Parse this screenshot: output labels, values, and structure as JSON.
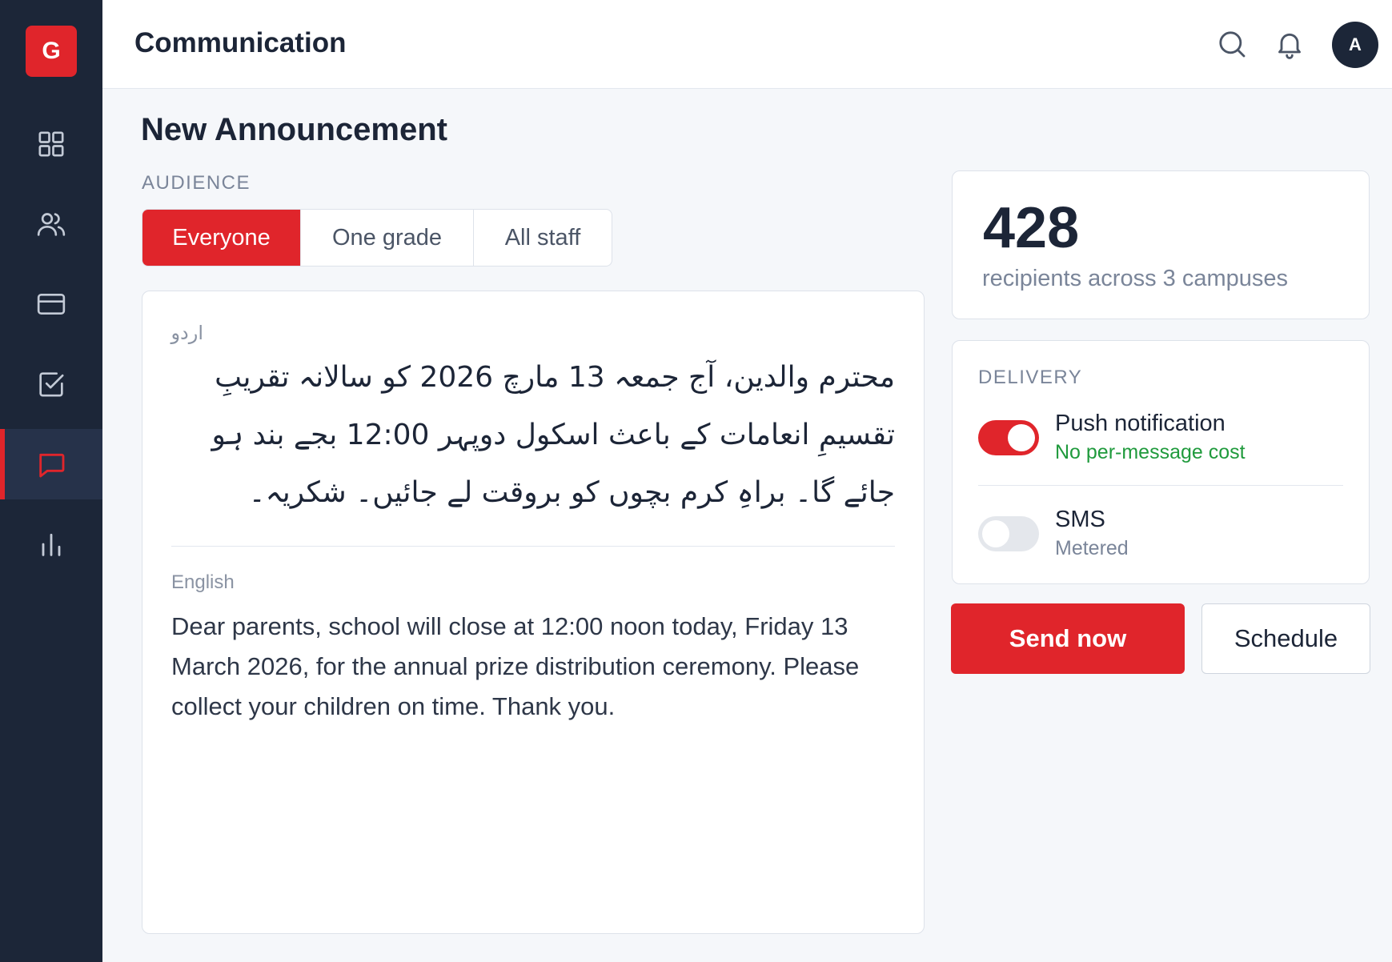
{
  "sidebar": {
    "logo_letter": "G",
    "items": [
      {
        "name": "dashboard",
        "icon": "grid-icon",
        "active": false
      },
      {
        "name": "people",
        "icon": "users-icon",
        "active": false
      },
      {
        "name": "billing",
        "icon": "credit-card-icon",
        "active": false
      },
      {
        "name": "tasks",
        "icon": "checkbox-icon",
        "active": false
      },
      {
        "name": "communication",
        "icon": "message-icon",
        "active": true
      },
      {
        "name": "reports",
        "icon": "bar-chart-icon",
        "active": false
      }
    ]
  },
  "header": {
    "title": "Communication",
    "search_icon": "search-icon",
    "bell_icon": "bell-icon",
    "avatar_initial": "A"
  },
  "page": {
    "title": "New Announcement"
  },
  "audience": {
    "label": "AUDIENCE",
    "options": [
      "Everyone",
      "One grade",
      "All staff"
    ],
    "selected": "Everyone"
  },
  "message": {
    "urdu_label": "اردو",
    "urdu_text": "محترم والدین، آج جمعہ 13 مارچ 2026 کو سالانہ تقریبِ تقسیمِ انعامات کے باعث اسکول دوپہر 12:00 بجے بند ہو جائے گا۔ براہِ کرم بچوں کو بروقت لے جائیں۔ شکریہ۔",
    "english_label": "English",
    "english_text": "Dear parents, school will close at 12:00 noon today, Friday 13 March 2026, for the annual prize distribution ceremony. Please collect your children on time. Thank you."
  },
  "summary": {
    "count": "428",
    "caption": "recipients across 3 campuses"
  },
  "delivery": {
    "label": "DELIVERY",
    "options": [
      {
        "title": "Push notification",
        "subtitle": "No per-message cost",
        "enabled": true,
        "subtitle_color": "#1f9a3c"
      },
      {
        "title": "SMS",
        "subtitle": "Metered",
        "enabled": false,
        "subtitle_color": "#7a8599"
      }
    ]
  },
  "actions": {
    "send_label": "Send now",
    "schedule_label": "Schedule"
  },
  "colors": {
    "accent": "#e0252b",
    "sidebar_bg": "#1c2638",
    "success": "#1f9a3c"
  }
}
